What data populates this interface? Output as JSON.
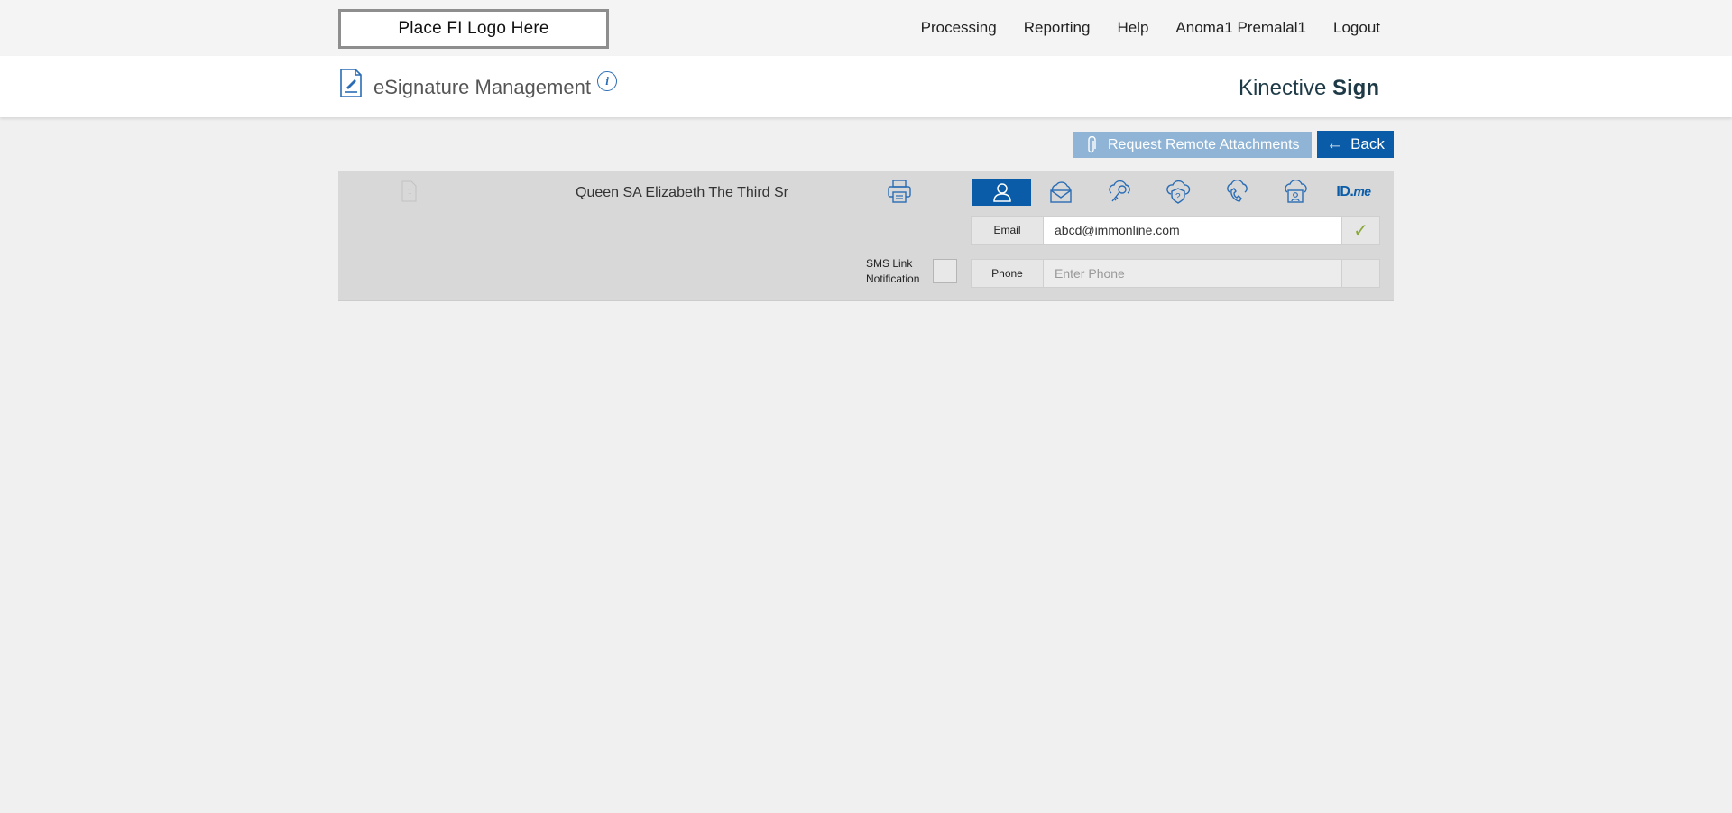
{
  "header": {
    "logo_placeholder": "Place FI Logo Here",
    "nav": [
      "Processing",
      "Reporting",
      "Help",
      "Anoma1 Premalal1",
      "Logout"
    ]
  },
  "title_bar": {
    "title": "eSignature Management",
    "info_glyph": "i",
    "brand_light": "Kinective",
    "brand_bold": "Sign"
  },
  "actions": {
    "request_attachments_label": "Request Remote Attachments",
    "back_label": "Back"
  },
  "signer": {
    "name": "Queen SA Elizabeth The Third Sr",
    "page_number": "1",
    "auth_methods": [
      {
        "icon": "person-icon",
        "active": true
      },
      {
        "icon": "email-cloud-icon",
        "active": false
      },
      {
        "icon": "key-cloud-icon",
        "active": false
      },
      {
        "icon": "question-cloud-icon",
        "active": false
      },
      {
        "icon": "phone-cloud-icon",
        "active": false
      },
      {
        "icon": "id-card-cloud-icon",
        "active": false
      },
      {
        "icon": "idme-logo",
        "active": false
      }
    ],
    "idme_main": "ID.",
    "idme_suffix": "me",
    "email_label": "Email",
    "email_value": "abcd@immonline.com",
    "email_verified_glyph": "✓",
    "phone_label": "Phone",
    "phone_placeholder": "Enter Phone",
    "phone_value": "",
    "sms_label_line1": "SMS Link",
    "sms_label_line2": "Notification",
    "sms_checked": false
  },
  "colors": {
    "primary_blue": "#0a5ca8",
    "disabled_blue": "#8fb4d6",
    "brand_text": "#1d3a46",
    "check_green": "#8aa83a"
  }
}
